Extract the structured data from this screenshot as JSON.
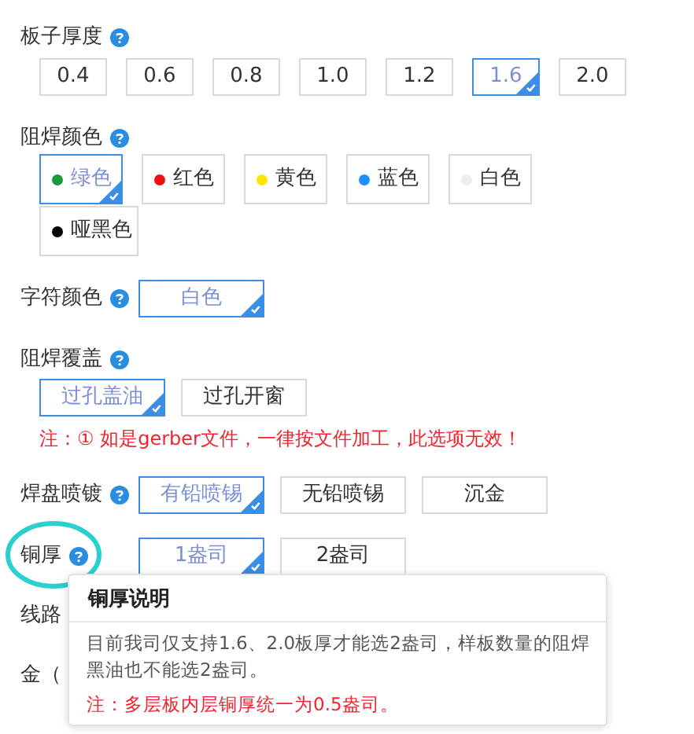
{
  "sections": [
    {
      "label": "板子厚度",
      "kind": "thickness",
      "options": [
        {
          "label": "0.4",
          "selected": false
        },
        {
          "label": "0.6",
          "selected": false
        },
        {
          "label": "0.8",
          "selected": false
        },
        {
          "label": "1.0",
          "selected": false
        },
        {
          "label": "1.2",
          "selected": false
        },
        {
          "label": "1.6",
          "selected": true
        },
        {
          "label": "2.0",
          "selected": false
        }
      ]
    },
    {
      "label": "阻焊颜色",
      "kind": "color",
      "options": [
        {
          "label": "绿色",
          "selected": true,
          "color": "#1a9a3c"
        },
        {
          "label": "红色",
          "selected": false,
          "color": "#ee1111"
        },
        {
          "label": "黄色",
          "selected": false,
          "color": "#ffe600"
        },
        {
          "label": "蓝色",
          "selected": false,
          "color": "#1e8fff"
        },
        {
          "label": "白色",
          "selected": false,
          "color": "#eeeeee"
        },
        {
          "label": "哑黑色",
          "selected": false,
          "color": "#000000"
        }
      ]
    },
    {
      "label": "字符颜色",
      "kind": "inline",
      "options": [
        {
          "label": "白色",
          "selected": true
        }
      ]
    },
    {
      "label": "阻焊覆盖",
      "kind": "wide",
      "options": [
        {
          "label": "过孔盖油",
          "selected": true
        },
        {
          "label": "过孔开窗",
          "selected": false
        }
      ],
      "note": "注：① 如是gerber文件，一律按文件加工，此选项无效！"
    },
    {
      "label": "焊盘喷镀",
      "kind": "inline",
      "options": [
        {
          "label": "有铅喷锡",
          "selected": true
        },
        {
          "label": "无铅喷锡",
          "selected": false
        },
        {
          "label": "沉金",
          "selected": false
        }
      ]
    },
    {
      "label": "铜厚",
      "kind": "inline",
      "circled": true,
      "options": [
        {
          "label": "1盎司",
          "selected": true
        },
        {
          "label": "2盎司",
          "selected": false
        }
      ]
    }
  ],
  "partial_rows": [
    "线路",
    "金（"
  ],
  "tooltip": {
    "title": "铜厚说明",
    "text": "目前我司仅支持1.6、2.0板厚才能选2盎司，样板数量的阻焊黑油也不能选2盎司。",
    "note": "注：多层板内层铜厚统一为0.5盎司。"
  }
}
